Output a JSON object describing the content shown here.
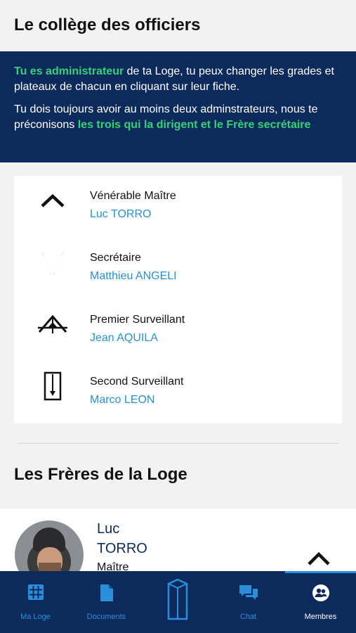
{
  "header": {
    "title": "Le collège des officiers"
  },
  "info": {
    "p1_highlight": "Tu es administrateur",
    "p1_rest": " de ta Loge, tu peux changer les grades et plateaux de chacun en cliquant sur leur fiche.",
    "p2_start": "Tu dois toujours avoir au moins deux adminstrateurs, nous te préconisons ",
    "p2_highlight": "les trois qui la dirigent et le Frère secrétaire"
  },
  "officers": [
    {
      "role": "Vénérable Maître",
      "name": "Luc TORRO",
      "icon": "chevron-up-icon"
    },
    {
      "role": "Secrétaire",
      "name": "Matthieu ANGELI",
      "icon": "crossed-quills-icon"
    },
    {
      "role": "Premier Surveillant",
      "name": "Jean AQUILA",
      "icon": "level-icon"
    },
    {
      "role": "Second Surveillant",
      "name": "Marco LEON",
      "icon": "plumb-line-icon"
    }
  ],
  "members_section": {
    "title": "Les Frères de la Loge"
  },
  "members": [
    {
      "first_name": "Luc",
      "last_name": "TORRO",
      "grade": "Maître",
      "icon": "chevron-up-icon"
    }
  ],
  "tabbar": {
    "tabs": [
      {
        "label": "Ma Loge",
        "icon": "grid-icon"
      },
      {
        "label": "Documents",
        "icon": "document-icon"
      },
      {
        "label": "",
        "icon": "pillar-icon"
      },
      {
        "label": "Chat",
        "icon": "chat-icon"
      },
      {
        "label": "Membres",
        "icon": "members-icon",
        "active": true
      }
    ]
  },
  "colors": {
    "navy": "#0d2a5c",
    "accent_green": "#36d178",
    "link_blue": "#2a8fd8"
  }
}
